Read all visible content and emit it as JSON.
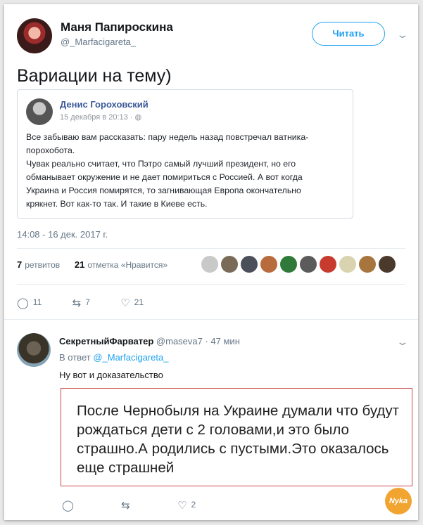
{
  "tweet": {
    "author_name": "Маня Папироскина",
    "author_handle": "@_Marfacigareta_",
    "follow_label": "Читать",
    "caret_icon": "chevron-down-icon",
    "text": "Вариации на тему)",
    "timestamp": "14:08 - 16 дек. 2017 г.",
    "retweets_count": "7",
    "retweets_label": "ретвитов",
    "likes_count": "21",
    "likes_label": "отметка «Нравится»",
    "actions": {
      "reply_count": "11",
      "retweet_count": "7",
      "like_count": "21"
    }
  },
  "embedded_post": {
    "author_name": "Денис Гороховский",
    "date": "15 декабря в 20:13 · ",
    "globe_icon": "globe-icon",
    "lines": [
      "Все забываю вам рассказать: пару недель назад повстречал ватника-",
      "порохобота.",
      "Чувак реально считает, что Пэтро самый лучший президент, но его",
      "обманывает окружение и не дает помириться с Россией. А вот когда",
      "Украина и Россия помирятся, то загнивающая Европа окончательно",
      "крякнет. Вот как-то так. И такие в Киеве есть."
    ]
  },
  "likers": [
    {
      "color": "#c9c9c9"
    },
    {
      "color": "#7a6a58"
    },
    {
      "color": "#4a4f5a"
    },
    {
      "color": "#b86b3c"
    },
    {
      "color": "#2f7a3a"
    },
    {
      "color": "#5b5b5b"
    },
    {
      "color": "#c73b2f"
    },
    {
      "color": "#d9d3b0"
    },
    {
      "color": "#a8753e"
    },
    {
      "color": "#4b3a2c"
    }
  ],
  "reply": {
    "author_name": "СекретныйФарватер",
    "author_handle": "@maseva7",
    "time": " · 47 мин",
    "reply_to_prefix": "В ответ ",
    "reply_to_handle": "@_Marfacigareta_",
    "text": "Ну вот и доказательство",
    "quote_text": "После Чернобыля на Украине думали что будут рождаться дети с 2 головами,и это было страшно.А родились с пустыми.Это оказалось еще страшней",
    "actions": {
      "like_count": "2"
    }
  },
  "watermark": "Nyka",
  "colors": {
    "accent": "#1da1f2",
    "facebook_blue": "#3b5998",
    "quote_border": "#c94a4a",
    "watermark": "#f2a431"
  }
}
